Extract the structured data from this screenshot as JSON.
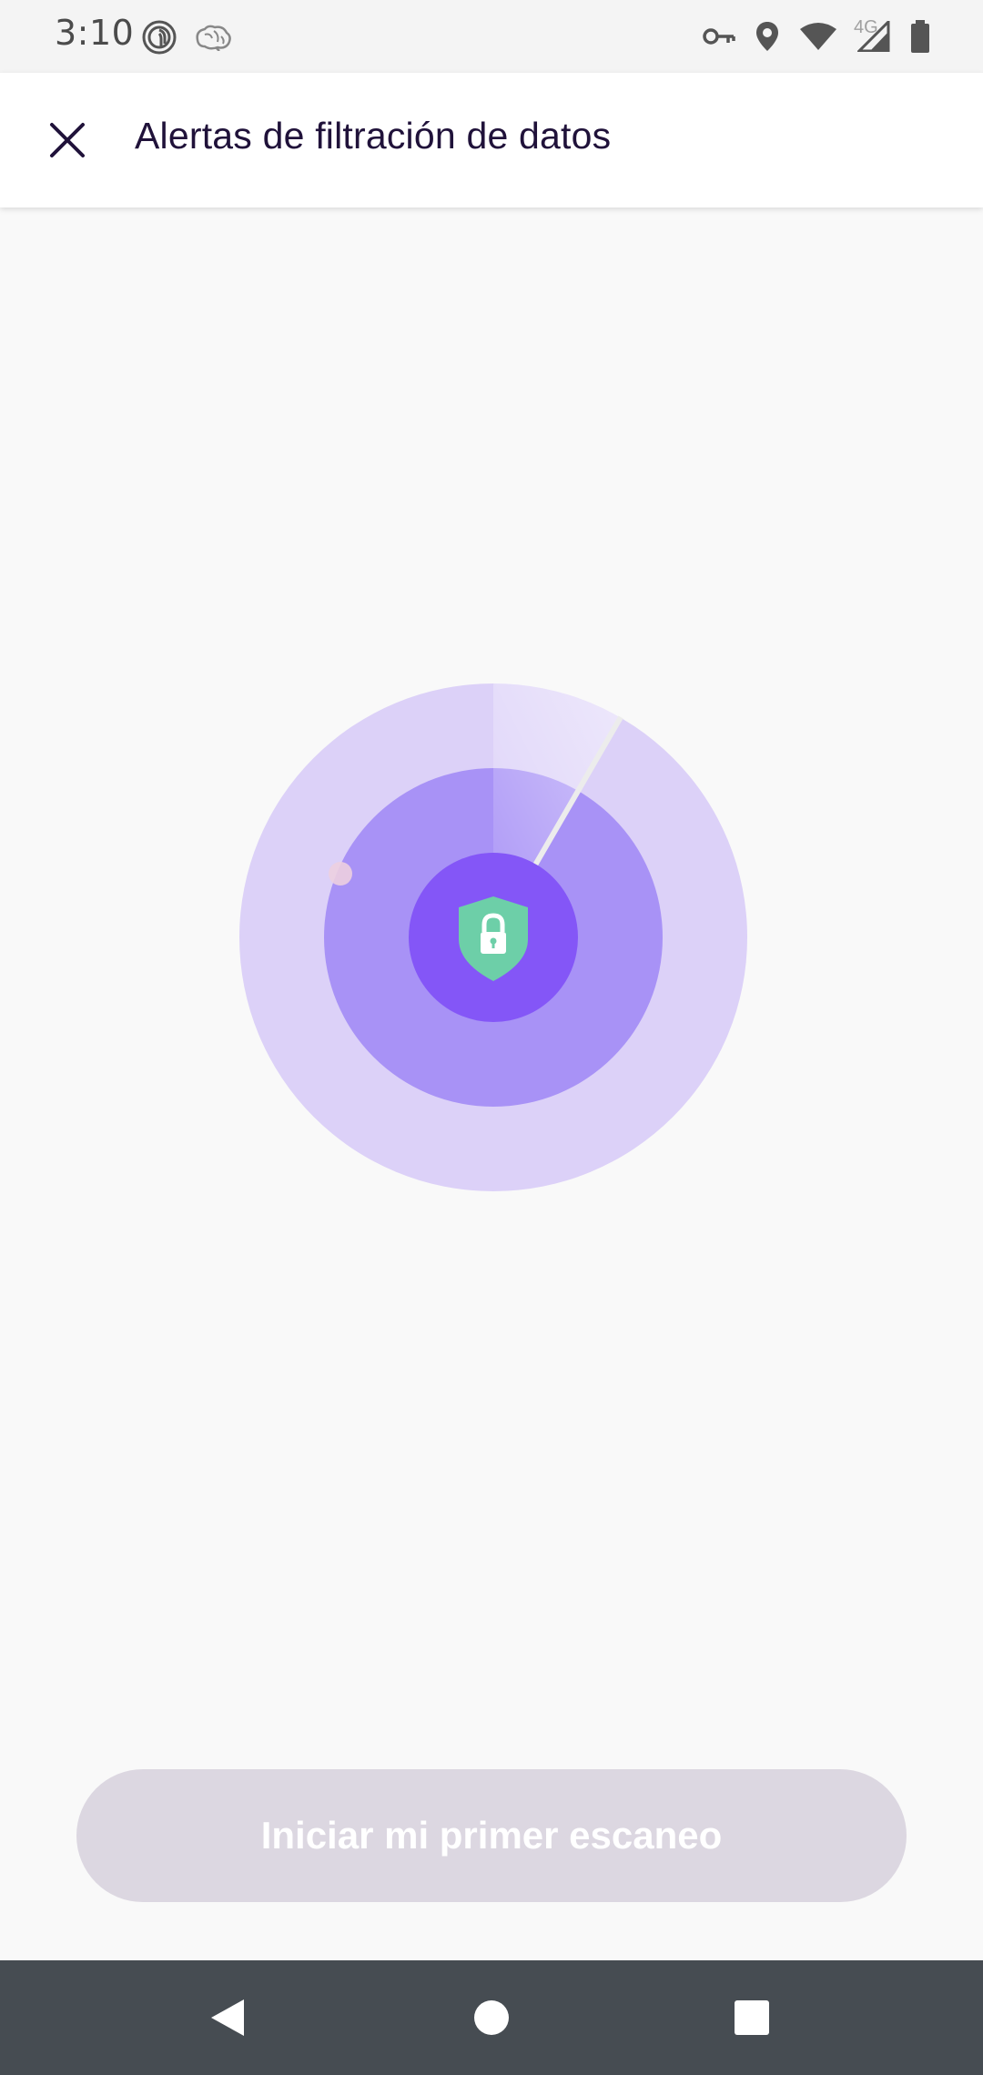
{
  "status_bar": {
    "time": "3:10",
    "left_icons": [
      "fingerprint-app-icon",
      "brain-app-icon"
    ],
    "right_icons": [
      "vpn-key-icon",
      "location-icon",
      "wifi-icon",
      "cellular-signal-icon",
      "battery-icon"
    ],
    "network_type": "4G"
  },
  "app_bar": {
    "title": "Alertas de filtración de datos",
    "close_icon": "close-icon"
  },
  "illustration": {
    "center_icon": "shield-lock-icon",
    "colors": {
      "outer_ring": "#dcd1f8",
      "middle_ring": "#a892f6",
      "inner_circle": "#8456f7",
      "shield": "#6dcfa8"
    }
  },
  "cta": {
    "label": "Iniciar mi primer escaneo",
    "enabled": false,
    "background": "#dcd7e1"
  },
  "nav_bar": {
    "buttons": [
      "back-icon",
      "home-icon",
      "recents-icon"
    ]
  }
}
